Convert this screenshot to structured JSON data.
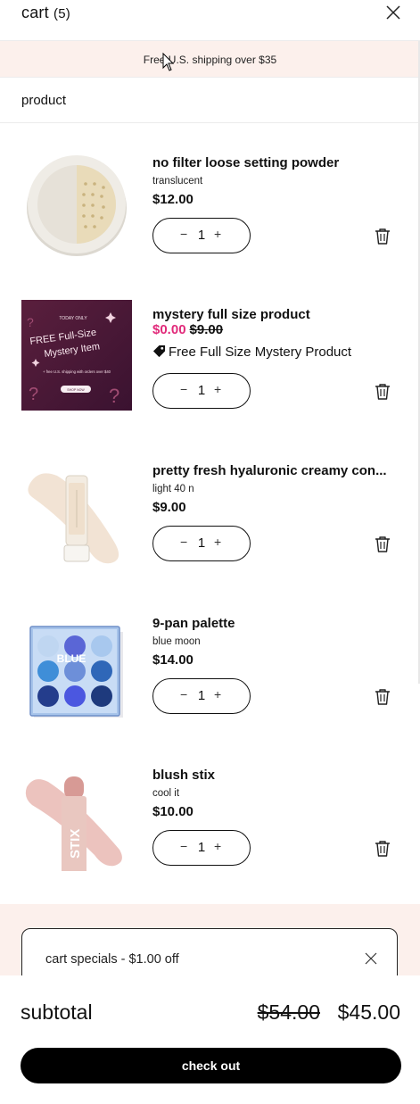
{
  "header": {
    "title": "cart",
    "count": "(5)"
  },
  "banner": {
    "text": "Free U.S. shipping over $35"
  },
  "section": {
    "title": "product"
  },
  "items": [
    {
      "name": "no filter loose setting powder",
      "variant": "translucent",
      "price": "$12.00",
      "qty": "1",
      "minus": "−",
      "plus": "+"
    },
    {
      "name": "mystery full size product",
      "sale_price": "$0.00",
      "original_price": "$9.00",
      "promo": "Free Full Size Mystery Product",
      "qty": "1",
      "minus": "−",
      "plus": "+",
      "image_text": {
        "top": "TODAY ONLY",
        "line1": "FREE Full-Size",
        "line2": "Mystery Item",
        "line3": "+ free U.S. shipping with orders over $40",
        "button": "SHOP NOW"
      }
    },
    {
      "name": "pretty fresh hyaluronic creamy con...",
      "variant": "light 40 n",
      "price": "$9.00",
      "qty": "1",
      "minus": "−",
      "plus": "+"
    },
    {
      "name": "9-pan palette",
      "variant": "blue moon",
      "price": "$14.00",
      "qty": "1",
      "minus": "−",
      "plus": "+",
      "image_text": {
        "logo": "BLUE"
      }
    },
    {
      "name": "blush stix",
      "variant": "cool it",
      "price": "$10.00",
      "qty": "1",
      "minus": "−",
      "plus": "+",
      "image_text": {
        "logo": "STIX"
      }
    }
  ],
  "specials": {
    "label": "cart specials - $1.00 off"
  },
  "footer": {
    "subtotal_label": "subtotal",
    "original_total": "$54.00",
    "total": "$45.00",
    "checkout_label": "check out"
  },
  "icons": {
    "close": "close-icon",
    "trash": "trash-icon",
    "tag": "tag-icon",
    "cursor": "mouse-cursor-icon"
  },
  "colors": {
    "banner_bg": "#fcf0ec",
    "sale": "#e12a7a",
    "checkout_bg": "#000000"
  }
}
